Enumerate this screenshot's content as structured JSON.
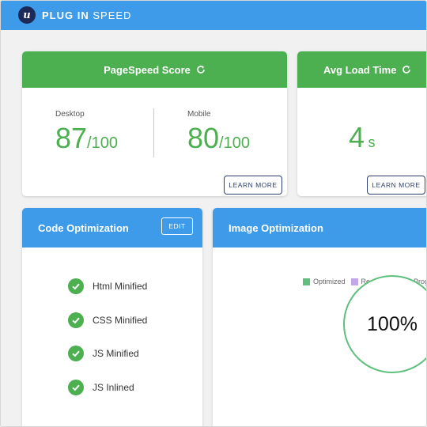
{
  "app": {
    "logo_letter": "u",
    "brand_bold": "PLUG IN",
    "brand_light": "SPEED"
  },
  "pagespeed": {
    "title": "PageSpeed Score",
    "desktop": {
      "label": "Desktop",
      "score": "87",
      "max": "/100"
    },
    "mobile": {
      "label": "Mobile",
      "score": "80",
      "max": "/100"
    },
    "button": "LEARN MORE"
  },
  "load_time": {
    "title": "Avg Load Time",
    "value": "4",
    "unit": "s",
    "button": "LEARN MORE"
  },
  "code_opt": {
    "title": "Code Optimization",
    "edit": "EDIT",
    "items": [
      "Html Minified",
      "CSS Minified",
      "JS Minified",
      "JS Inlined"
    ]
  },
  "image_opt": {
    "title": "Image Optimization",
    "legend": [
      {
        "label": "Optimized",
        "color": "#5fbf7d"
      },
      {
        "label": "Restored",
        "color": "#c3a6e6"
      },
      {
        "label": "In Prog",
        "color": "#bfe6ee"
      }
    ],
    "percent": "100%"
  },
  "colors": {
    "accent_green": "#4caf50",
    "accent_blue": "#3d9be9",
    "navy": "#1d2a57"
  }
}
